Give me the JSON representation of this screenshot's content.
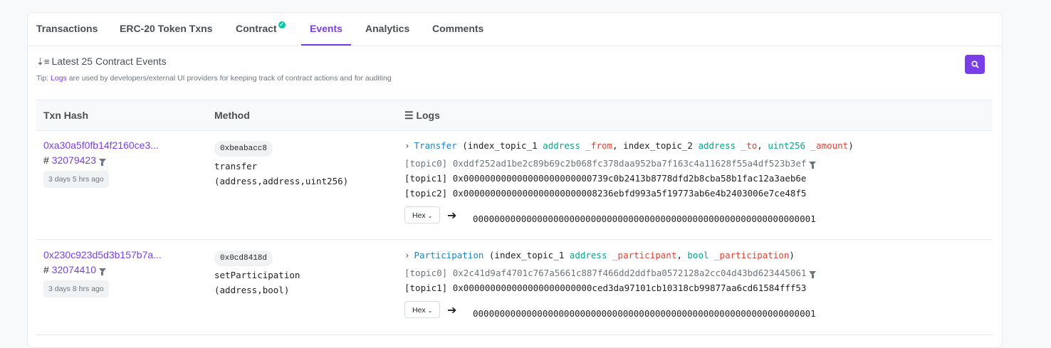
{
  "tabs": [
    {
      "label": "Transactions"
    },
    {
      "label": "ERC-20 Token Txns"
    },
    {
      "label": "Contract"
    },
    {
      "label": "Events"
    },
    {
      "label": "Analytics"
    },
    {
      "label": "Comments"
    }
  ],
  "events": {
    "title": "Latest 25 Contract Events",
    "tip_prefix": "Tip: ",
    "tip_link": "Logs",
    "tip_rest": " are used by developers/external UI providers for keeping track of contract actions and for auditing"
  },
  "table": {
    "headers": {
      "hash": "Txn Hash",
      "method": "Method",
      "logs": "Logs"
    }
  },
  "rows": [
    {
      "hash": "0xa30a5f0fb14f2160ce3...",
      "block_prefix": "# ",
      "block": "32079423",
      "age": "3 days 5 hrs ago",
      "method_id": "0xbeabacc8",
      "method_name": "transfer",
      "method_args": "(address,address,uint256)",
      "event_name": "Transfer",
      "sig_open": " (index_topic_1 ",
      "p1_type": "address",
      "p1_name": "_from",
      "sep1": ", index_topic_2 ",
      "p2_type": "address",
      "p2_name": "_to",
      "sep2": ", ",
      "p3_type": "uint256",
      "p3_name": "_amount",
      "sig_close": ")",
      "topic0_label": "[topic0]",
      "topic0": "0xddf252ad1be2c89b69c2b068fc378daa952ba7f163c4a11628f55a4df523b3ef",
      "topic1_label": "[topic1]",
      "topic1": "0x000000000000000000000000739c0b2413b8778dfd2b8cba58b1fac12a3aeb6e",
      "topic2_label": "[topic2]",
      "topic2": "0x0000000000000000000000008236ebfd993a5f19773ab6e4b2403006e7ce48f5",
      "format": "Hex",
      "data": "0000000000000000000000000000000000000000000000000000000000000001"
    },
    {
      "hash": "0x230c923d5d3b157b7a...",
      "block_prefix": "# ",
      "block": "32074410",
      "age": "3 days 8 hrs ago",
      "method_id": "0x0cd8418d",
      "method_name": "setParticipation",
      "method_args": "(address,bool)",
      "event_name": "Participation",
      "sig_open": " (index_topic_1 ",
      "p1_type": "address",
      "p1_name": "_participant",
      "sep1": ", ",
      "p2_type": "bool",
      "p2_name": "_participation",
      "sig_close": ")",
      "topic0_label": "[topic0]",
      "topic0": "0x2c41d9af4701c767a5661c887f466dd2ddfba0572128a2cc04d43bd623445061",
      "topic1_label": "[topic1]",
      "topic1": "0x000000000000000000000000ced3da97101cb10318cb99877aa6cd61584fff53",
      "format": "Hex",
      "data": "0000000000000000000000000000000000000000000000000000000000000001"
    }
  ]
}
